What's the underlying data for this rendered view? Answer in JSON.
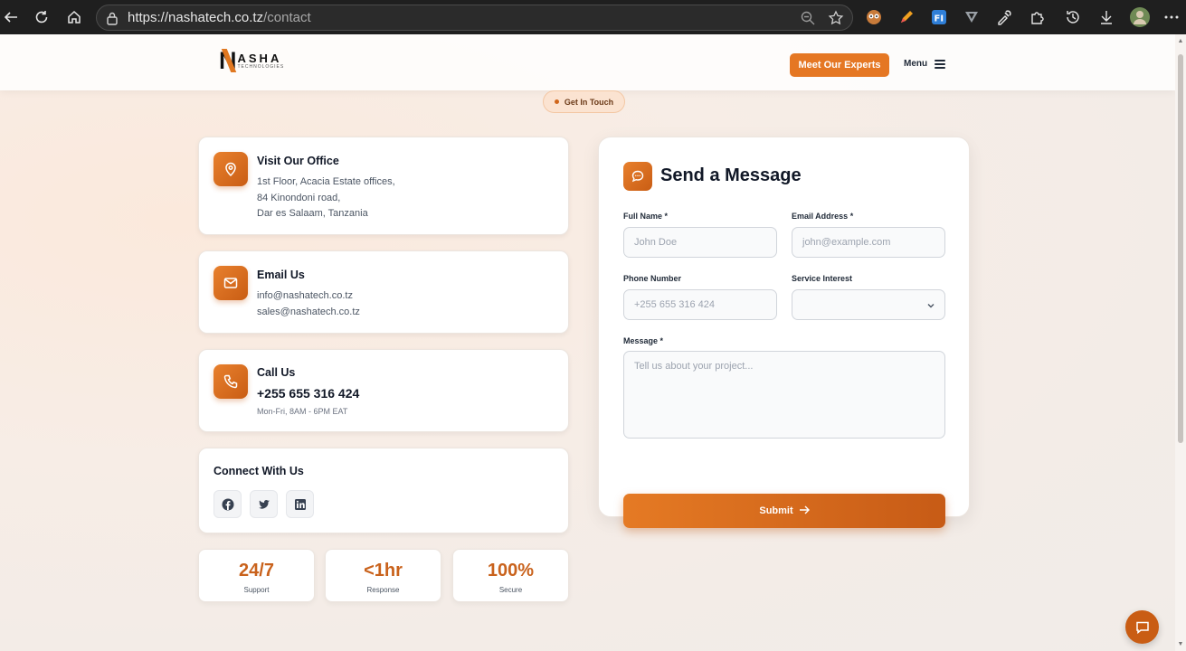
{
  "browser": {
    "url_host": "https://nashatech.co.tz",
    "url_path": "/contact"
  },
  "header": {
    "logo_big": "ASHA",
    "logo_letter": "N",
    "logo_small": "TECHNOLOGIES",
    "cta_label": "Meet Our Experts",
    "menu_label": "Menu"
  },
  "badge": {
    "label": "Get In Touch"
  },
  "office": {
    "title": "Visit Our Office",
    "lines": [
      "1st Floor, Acacia Estate offices,",
      "84 Kinondoni road,",
      "Dar es Salaam, Tanzania"
    ]
  },
  "email": {
    "title": "Email Us",
    "lines": [
      "info@nashatech.co.tz",
      "sales@nashatech.co.tz"
    ]
  },
  "call": {
    "title": "Call Us",
    "phone": "+255 655 316 424",
    "hours": "Mon-Fri, 8AM - 6PM EAT"
  },
  "connect": {
    "title": "Connect With Us",
    "networks": [
      "facebook-icon",
      "twitter-icon",
      "linkedin-icon"
    ]
  },
  "stats": [
    {
      "value": "24/7",
      "label": "Support"
    },
    {
      "value": "<1hr",
      "label": "Response"
    },
    {
      "value": "100%",
      "label": "Secure"
    }
  ],
  "form": {
    "title": "Send a Message",
    "full_name_label": "Full Name *",
    "full_name_placeholder": "John Doe",
    "email_label": "Email Address *",
    "email_placeholder": "john@example.com",
    "phone_label": "Phone Number",
    "phone_placeholder": "+255 655 316 424",
    "service_label": "Service Interest",
    "service_value": "",
    "message_label": "Message *",
    "message_placeholder": "Tell us about your project...",
    "submit_label": "Submit"
  },
  "colors": {
    "accent": "#e57723",
    "accent_dark": "#c95d14",
    "chrome_bg": "#1f1f1f"
  }
}
